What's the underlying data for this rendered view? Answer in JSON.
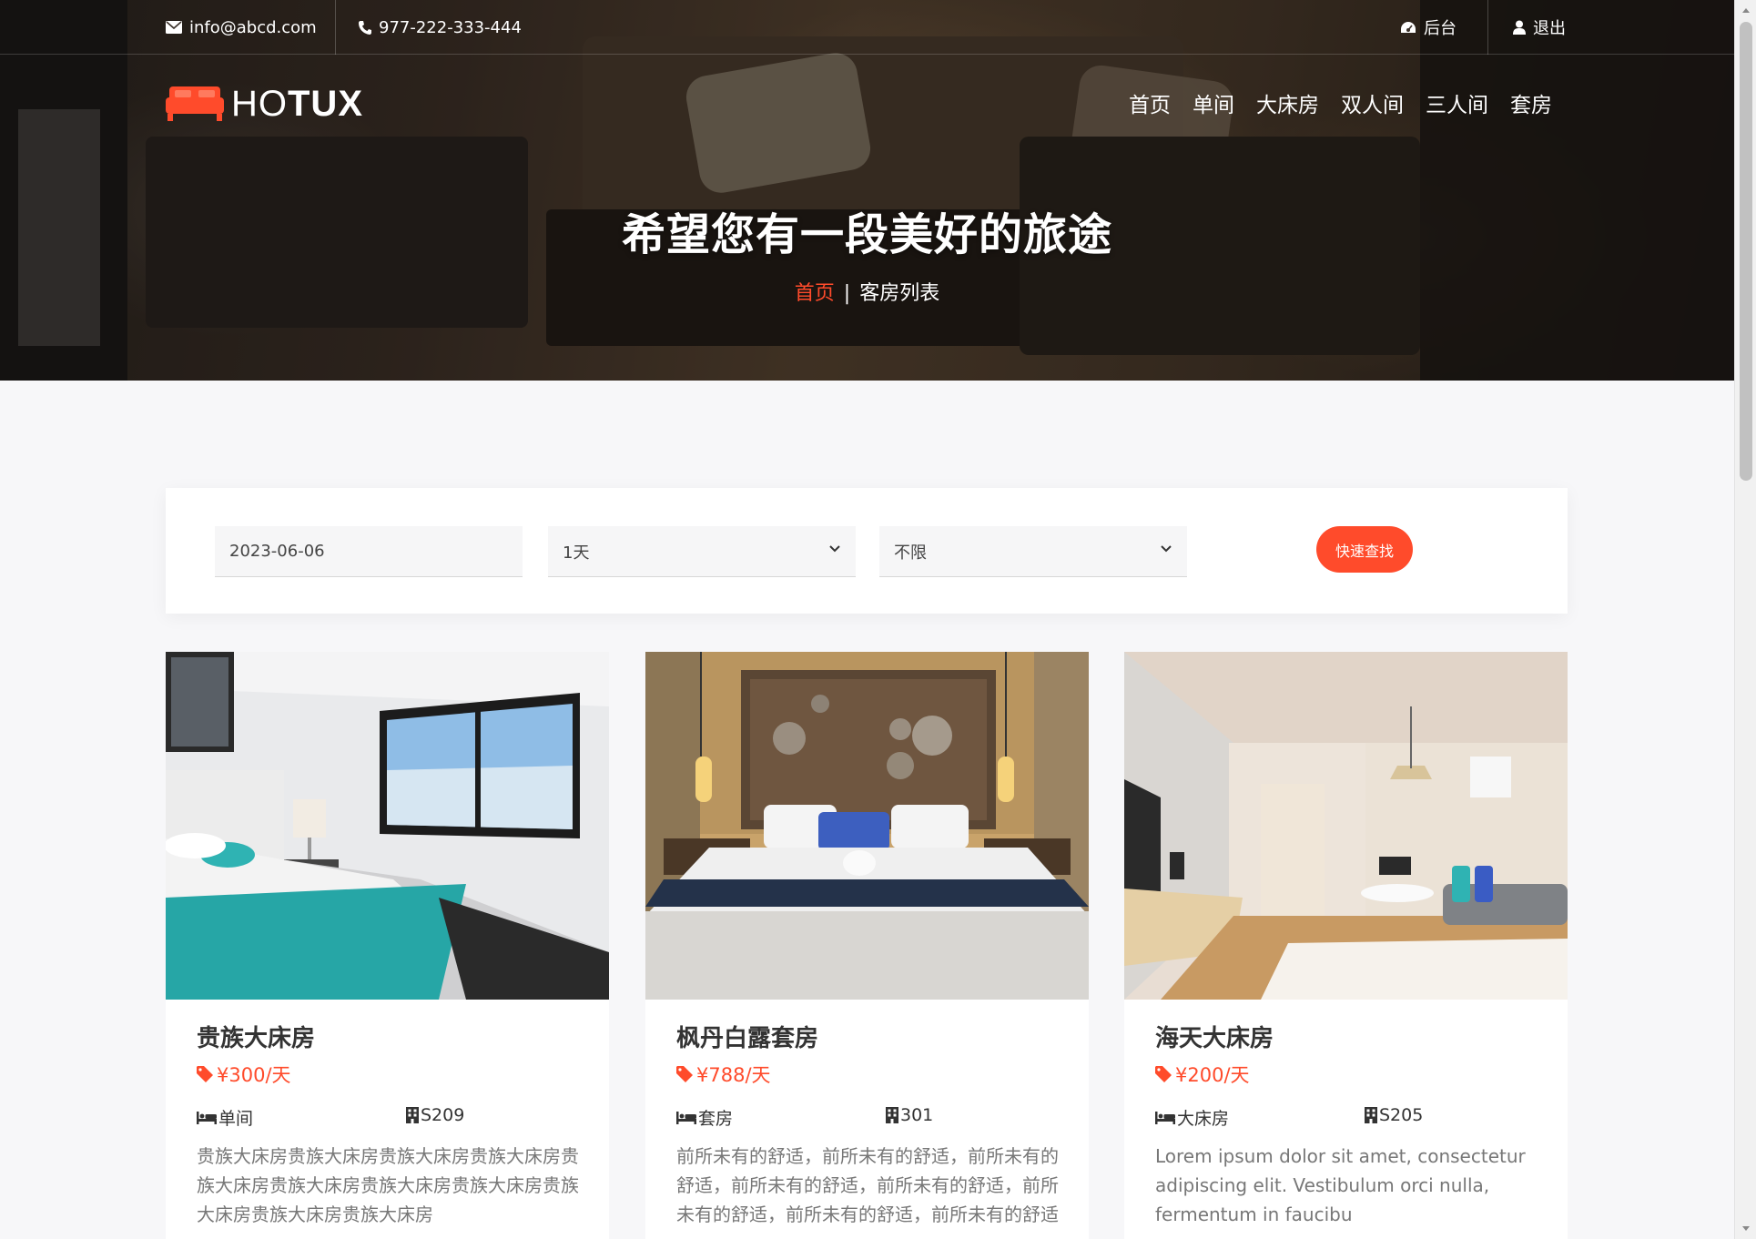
{
  "topbar": {
    "email": "info@abcd.com",
    "phone": "977-222-333-444",
    "admin_label": "后台",
    "logout_label": "退出"
  },
  "brand": {
    "logo_thin": "HO",
    "logo_bold": "TUX",
    "accent_color": "#ff4b2b"
  },
  "nav": {
    "items": [
      "首页",
      "单间",
      "大床房",
      "双人间",
      "三人间",
      "套房"
    ]
  },
  "hero": {
    "title": "希望您有一段美好的旅途",
    "breadcrumb_home": "首页",
    "breadcrumb_separator": "|",
    "breadcrumb_current": "客房列表"
  },
  "search": {
    "date_value": "2023-06-06",
    "days_value": "1天",
    "type_value": "不限",
    "button_label": "快速查找"
  },
  "rooms": [
    {
      "name": "贵族大床房",
      "price": "¥300/天",
      "type": "单间",
      "room_no": "S209",
      "description": "贵族大床房贵族大床房贵族大床房贵族大床房贵族大床房贵族大床房贵族大床房贵族大床房贵族大床房贵族大床房贵族大床房",
      "image": "bedroom-teal-blanket"
    },
    {
      "name": "枫丹白露套房",
      "price": "¥788/天",
      "type": "套房",
      "room_no": "301",
      "description": "前所未有的舒适，前所未有的舒适，前所未有的舒适，前所未有的舒适，前所未有的舒适，前所未有的舒适，前所未有的舒适，前所未有的舒适",
      "image": "hotel-bed-wood-headboard"
    },
    {
      "name": "海天大床房",
      "price": "¥200/天",
      "type": "大床房",
      "room_no": "S205",
      "description": "Lorem ipsum dolor sit amet, consectetur adipiscing elit. Vestibulum orci nulla, fermentum in faucibu",
      "image": "studio-room-wood-floor"
    }
  ]
}
